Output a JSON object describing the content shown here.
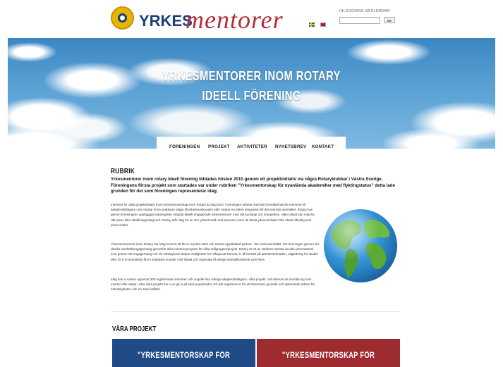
{
  "brand": {
    "logo_word_1": "YRKES",
    "logo_word_2": "mentorer",
    "colors": {
      "blue": "#1f3c7a",
      "red": "#b22d3a",
      "gold": "#e8b400"
    }
  },
  "header": {
    "flags": [
      "swedish-flag-icon",
      "british-flag-icon"
    ],
    "login": {
      "label": "INLOGGNING MEDLEMMAR",
      "input_value": "",
      "button": "OK"
    }
  },
  "hero": {
    "title_line_1": "YRKESMENTORER INOM ROTARY",
    "title_line_2": "IDEELL FÖRENING"
  },
  "nav": {
    "items": [
      "FÖRENINGEN",
      "PROJEKT",
      "AKTIVITETER",
      "NYHETSBREV",
      "KONTAKT"
    ]
  },
  "main": {
    "heading": "RUBRIK",
    "lead": "Yrkesmentorer inom rotary ideell förening bildades hösten 2010 genom ett projektinitiativ via några Rotaryklubbar i Västra Sverige. Föreningens första projekt som startades var under rubriken \"Yrkesmentorskap för nyanlända akademiker med flyktingstatus\" detta lade grunden för det som föreningen representerar idag.",
    "paragraphs": [
      "Intresset för olika projektinitiativ inom yrkesmentorskap inom Rotary är idag stort. Föreningen arbetar med att förmedla/matcha mentorer till adepter/deltagare som önskar finna snabbare vägar till arbetsmarknaden eller önskar en bättre integration till det svenska samhället. Rotary kan genom föreningens uppbyggda dataregister erbjuda ideellt engagerade yrkesmentorer med rätt kunskap och kompetens, vilket oftast kan matcha rätt yrkes eller utbildningsbakgrund. Rotary står idag för en stor yrkesbredd med personer inom de flesta yrkesområden från såväl offentlig som privat sektor.",
      "Yrkesmentorerna inom Rotary har idag kommit att bli en mycket stark och seriöst uppskattad partner i det civila samhället, där föreningen genom sitt ideella samhällsengagemang genomför olika mentorsprogram för olika målgrupper/projekt. Rotary är ett av världens största sociala yrkesnätverk som genom sitt engagemang och sin värdegrund skapar möjligheter för många att komma in, få kontakt på arbetsmarknaden, vägledning för studier eller för b la nyanlända få en snabbare kontakt i det lokala och regionala så viktiga samhällsnätverk som finns.",
      "Idag kan vi notera uppemot 300 registrerade mentorer och ungefär lika många adepter/deltagare i våra projekt. Vid intresse att anmäla sig som mentor eller adept i våra olika projekt ber vi er gå in på våra projektsidor och där registrera er för ett intressant, givande och spännande arbete för mänskligheten och en ökad välfärd."
    ]
  },
  "projects": {
    "heading": "VÅRA PROJEKT",
    "cards": [
      {
        "title": "\"YRKESMENTORSKAP FÖR",
        "color": "#1f4a86"
      },
      {
        "title": "\"YRKESMENTORSKAP FÖR",
        "color": "#9d2b30"
      }
    ]
  }
}
